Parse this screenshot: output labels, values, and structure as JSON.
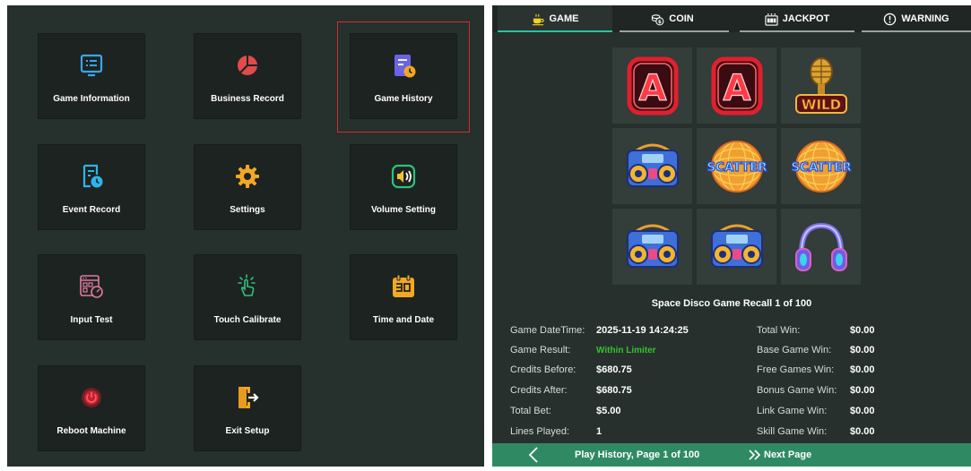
{
  "setup_menu": {
    "items": [
      {
        "label": "Game Information"
      },
      {
        "label": "Business Record"
      },
      {
        "label": "Game History"
      },
      {
        "label": "Event Record"
      },
      {
        "label": "Settings"
      },
      {
        "label": "Volume Setting"
      },
      {
        "label": "Input Test"
      },
      {
        "label": "Touch Calibrate"
      },
      {
        "label": "Time and Date"
      },
      {
        "label": "Reboot Machine"
      },
      {
        "label": "Exit Setup"
      }
    ],
    "selected": "Game History",
    "colors": {
      "selection_border": "#d42e2e",
      "panel": "#26302d",
      "tile": "#1d2321"
    }
  },
  "history": {
    "tabs": [
      {
        "label": "GAME",
        "icon": "coffee-cup-icon"
      },
      {
        "label": "COIN",
        "icon": "coin-icon"
      },
      {
        "label": "JACKPOT",
        "icon": "jackpot-machine-icon"
      },
      {
        "label": "WARNING",
        "icon": "warning-icon"
      }
    ],
    "active_tab": "GAME",
    "reels": [
      [
        "a-symbol",
        "a-symbol",
        "wild-microphone"
      ],
      [
        "boombox",
        "scatter-disco-ball",
        "scatter-disco-ball"
      ],
      [
        "boombox",
        "boombox",
        "headphones"
      ]
    ],
    "scatter_text": "SCATTER",
    "wild_text": "WILD",
    "a_text": "A",
    "recall_title": "Space Disco Game Recall 1 of 100",
    "left_info": [
      {
        "label": "Game DateTime:",
        "value": "2025-11-19 14:24:25"
      },
      {
        "label": "Game Result:",
        "value": "Within Limiter"
      },
      {
        "label": "Credits Before:",
        "value": "$680.75"
      },
      {
        "label": "Credits After:",
        "value": "$680.75"
      },
      {
        "label": "Total Bet:",
        "value": "$5.00"
      },
      {
        "label": "Lines Played:",
        "value": "1"
      }
    ],
    "right_info": [
      {
        "label": "Total Win:",
        "value": "$0.00"
      },
      {
        "label": "Base Game Win:",
        "value": "$0.00"
      },
      {
        "label": "Free Games Win:",
        "value": "$0.00"
      },
      {
        "label": "Bonus Game Win:",
        "value": "$0.00"
      },
      {
        "label": "Link Game Win:",
        "value": "$0.00"
      },
      {
        "label": "Skill Game Win:",
        "value": "$0.00"
      }
    ],
    "footer": {
      "page_text": "Play History, Page 1 of 100",
      "next_label": "Next Page"
    },
    "colors": {
      "accent": "#27c4a0",
      "footer": "#2f8a63",
      "result_green": "#31c42f"
    }
  }
}
